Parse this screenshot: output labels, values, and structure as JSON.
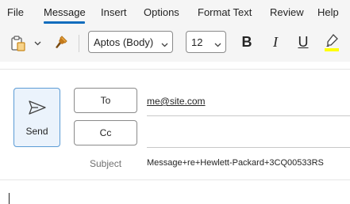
{
  "menu": {
    "items": [
      "File",
      "Message",
      "Insert",
      "Options",
      "Format Text",
      "Review",
      "Help"
    ],
    "active": "Message"
  },
  "ribbon": {
    "icons": {
      "paste": "clipboard-paste-icon",
      "format_painter": "format-painter-icon",
      "dropdown_arrow": "chevron-down-icon"
    },
    "font_name": "Aptos (Body)",
    "font_size": "12",
    "bold": "B",
    "italic": "I",
    "underline": "U",
    "highlight_color": "#ffff00",
    "accent_color": "#0f6cbd"
  },
  "compose": {
    "send_label": "Send",
    "to_label": "To",
    "cc_label": "Cc",
    "to_value": "me@site.com",
    "cc_value": "",
    "subject_label": "Subject",
    "subject_value": "Message+re+Hewlett-Packard+3CQ00533RS"
  }
}
